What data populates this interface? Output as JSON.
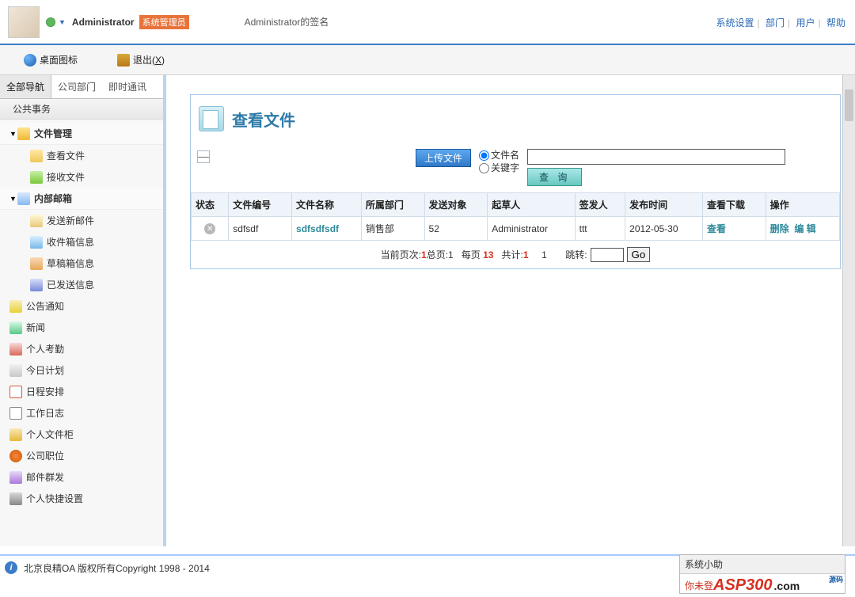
{
  "header": {
    "user": "Administrator",
    "role_badge": "系统管理员",
    "signature": "Administrator的签名",
    "links": [
      "系统设置",
      "部门",
      "用户",
      "帮助"
    ]
  },
  "toolbar": {
    "desktop": "桌面图标",
    "exit_prefix": "退出(",
    "exit_key": "X",
    "exit_suffix": ")"
  },
  "sidebar": {
    "tabs": [
      "全部导航",
      "公司部门",
      "即时通讯"
    ],
    "strip": "公共事务",
    "tree": [
      {
        "label": "文件管理",
        "bold": true,
        "arrow": true,
        "icon": "ico-folder"
      },
      {
        "label": "查看文件",
        "sub": true,
        "icon": "ico-folder-open"
      },
      {
        "label": "接收文件",
        "sub": true,
        "icon": "ico-folder-green"
      },
      {
        "label": "内部邮箱",
        "bold": true,
        "arrow": true,
        "icon": "ico-mail"
      },
      {
        "label": "发送新邮件",
        "sub": true,
        "icon": "ico-mail-new"
      },
      {
        "label": "收件箱信息",
        "sub": true,
        "icon": "ico-mail-in"
      },
      {
        "label": "草稿箱信息",
        "sub": true,
        "icon": "ico-draft"
      },
      {
        "label": "已发送信息",
        "sub": true,
        "icon": "ico-sent"
      },
      {
        "label": "公告通知",
        "icon": "ico-announce"
      },
      {
        "label": "新闻",
        "icon": "ico-news"
      },
      {
        "label": "个人考勤",
        "icon": "ico-attend"
      },
      {
        "label": "今日计划",
        "icon": "ico-plan"
      },
      {
        "label": "日程安排",
        "icon": "ico-calendar"
      },
      {
        "label": "工作日志",
        "icon": "ico-log"
      },
      {
        "label": "个人文件柜",
        "icon": "ico-filebox"
      },
      {
        "label": "公司职位",
        "icon": "ico-org"
      },
      {
        "label": "邮件群发",
        "icon": "ico-mailgroup"
      },
      {
        "label": "个人快捷设置",
        "icon": "ico-settings"
      }
    ]
  },
  "panel": {
    "title": "查看文件",
    "upload_btn": "上传文件",
    "radio_filename": "文件名",
    "radio_keyword": "关键字",
    "search_btn": "查 询",
    "collapse": "—"
  },
  "table": {
    "headers": [
      "状态",
      "文件编号",
      "文件名称",
      "所属部门",
      "发送对象",
      "起草人",
      "签发人",
      "发布时间",
      "查看下载",
      "操作"
    ],
    "row": {
      "code": "sdfsdf",
      "name": "sdfsdfsdf",
      "dept": "销售部",
      "target": "52",
      "drafter": "Administrator",
      "signer": "ttt",
      "pubtime": "2012-05-30",
      "view": "查看",
      "op_del": "删除",
      "op_edit": "编 辑"
    }
  },
  "pager": {
    "cur_label": "当前页次:",
    "cur": "1",
    "total_label": "总页:",
    "total": "1",
    "per_label": "每页",
    "per": "13",
    "count_label": "共计:",
    "count": "1",
    "one": "1",
    "jump_label": "跳转:",
    "go": "Go"
  },
  "footer": {
    "copyright": "北京良精OA 版权所有Copyright 1998 - 2014",
    "widget_title": "系统小助",
    "widget_msg": "你未登",
    "brand1": "ASP",
    "brand2": "300",
    "brand3": ".com",
    "brand_sub": "源码"
  }
}
